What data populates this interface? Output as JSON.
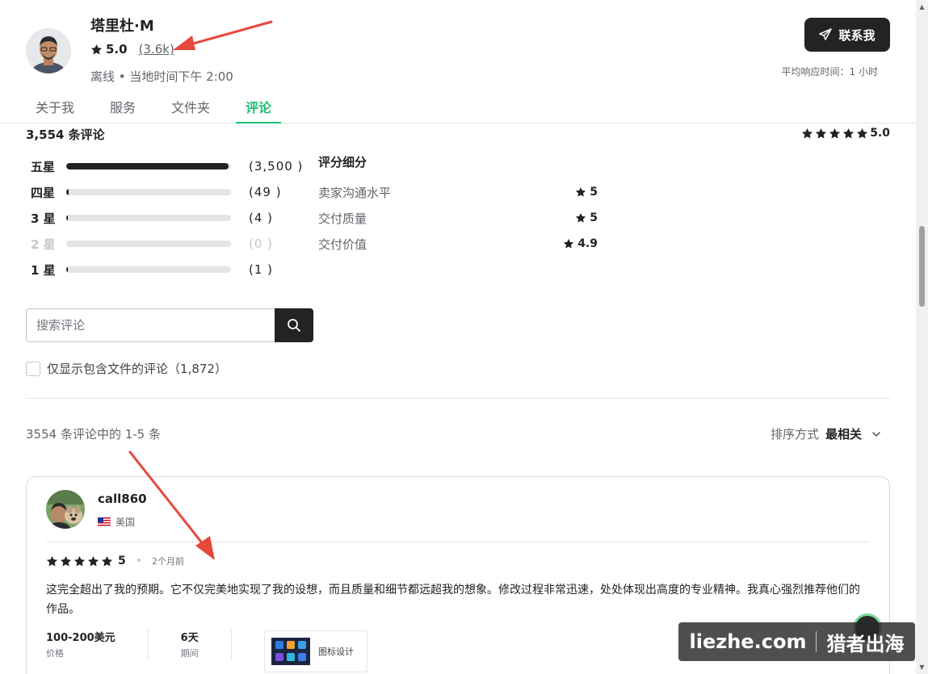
{
  "seller": {
    "name": "塔里杜·M",
    "rating": "5.0",
    "rating_count": "(3.6k)",
    "status": "离线 • 当地时间下午 2:00",
    "contact_label": "联系我",
    "response_time": "平均响应时间：1 小时"
  },
  "tabs": [
    {
      "label": "关于我",
      "active": false
    },
    {
      "label": "服务",
      "active": false
    },
    {
      "label": "文件夹",
      "active": false
    },
    {
      "label": "评论",
      "active": true
    }
  ],
  "reviews": {
    "title": "3,554 条评论",
    "overall": "5.0",
    "breakdown": [
      {
        "label": "五星",
        "count": "(3,500 )",
        "fraction": 0.985,
        "disabled": false
      },
      {
        "label": "四星",
        "count": "(49 )",
        "fraction": 0.014,
        "disabled": false
      },
      {
        "label": "3 星",
        "count": "(4 )",
        "fraction": 0.004,
        "disabled": false
      },
      {
        "label": "2 星",
        "count": "(0 )",
        "fraction": 0.0,
        "disabled": true
      },
      {
        "label": "1 星",
        "count": "(1 )",
        "fraction": 0.002,
        "disabled": false
      }
    ],
    "rating_breakdown_title": "评分细分",
    "rating_breakdown": [
      {
        "label": "卖家沟通水平",
        "score": "5"
      },
      {
        "label": "交付质量",
        "score": "5"
      },
      {
        "label": "交付价值",
        "score": "4.9"
      }
    ],
    "search_placeholder": "搜索评论",
    "filter_label": "仅显示包含文件的评论（1,872）",
    "showing": "3554 条评论中的 1-5 条",
    "sort_label": "排序方式",
    "sort_value": "最相关"
  },
  "review_card": {
    "reviewer": "call860",
    "country": "美国",
    "score": "5",
    "ago": "2个月前",
    "text": "这完全超出了我的预期。它不仅完美地实现了我的设想，而且质量和细节都远超我的想象。修改过程非常迅速，处处体现出高度的专业精神。我真心强烈推荐他们的作品。",
    "price_value": "100-200美元",
    "price_label": "价格",
    "duration_value": "6天",
    "duration_label": "期间",
    "gig_label": "图标设计"
  },
  "watermark": {
    "left": "liezhe.com",
    "right": "猎者出海"
  },
  "colors": {
    "accent": "#1dbf73",
    "dark": "#222325",
    "annotation": "#e8473b"
  }
}
